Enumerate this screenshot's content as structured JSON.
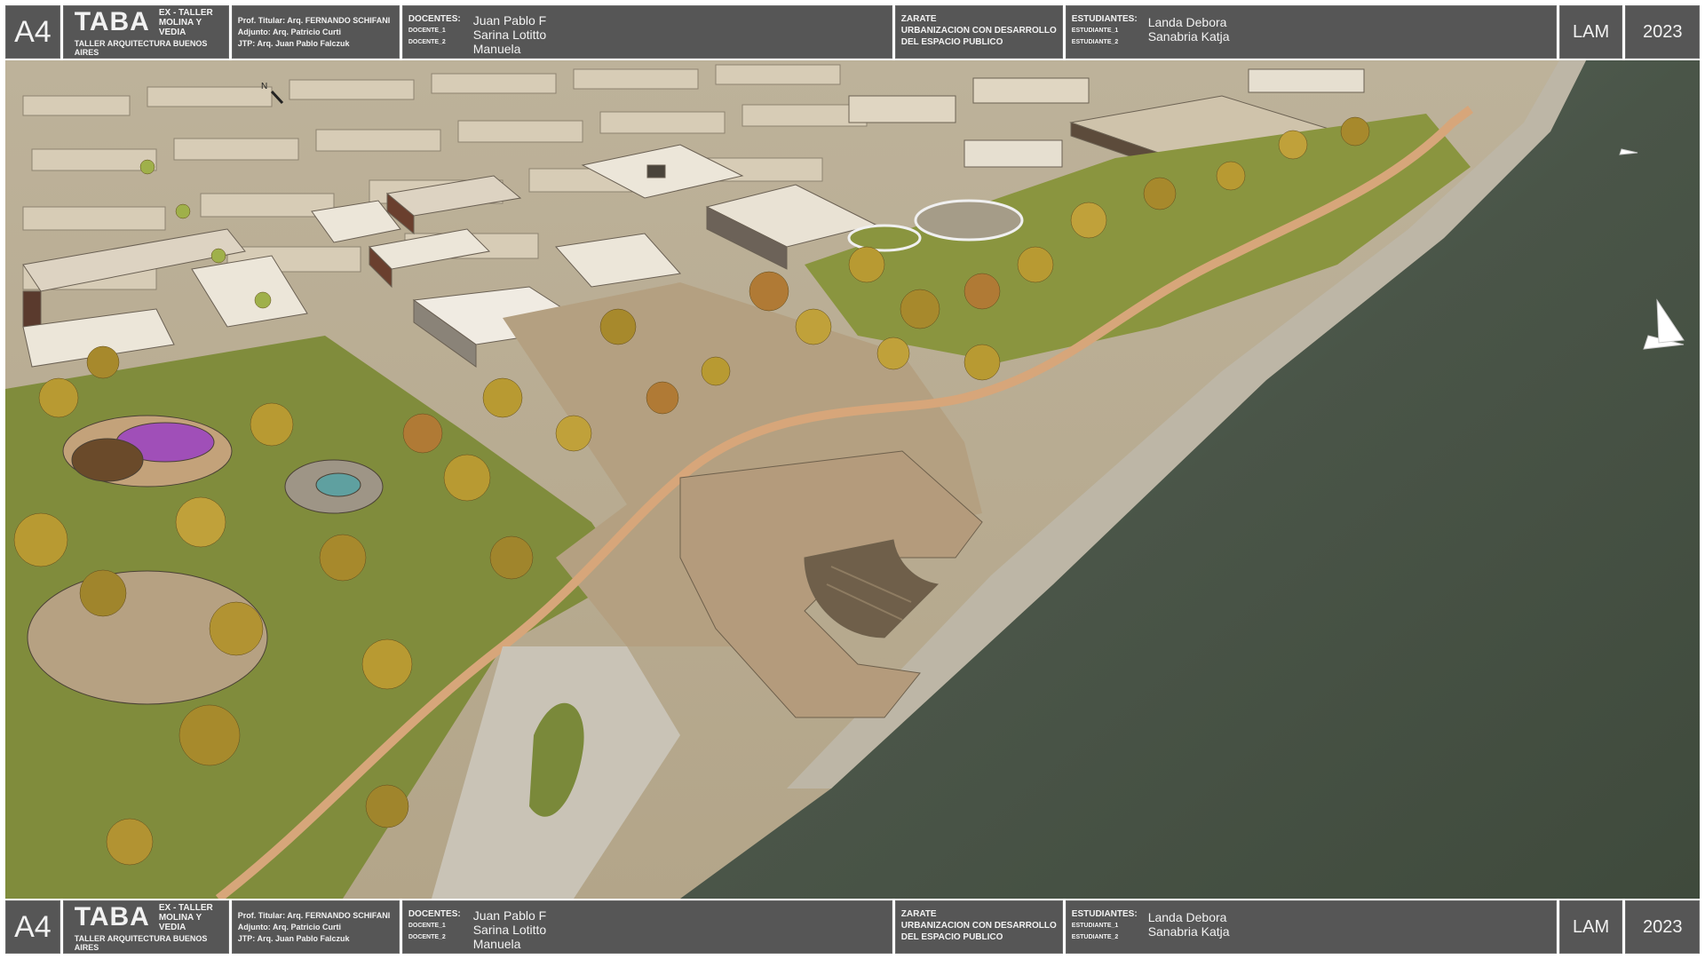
{
  "sheet": {
    "code": "A4",
    "logo": {
      "main": "TABA",
      "side_line1": "EX - TALLER",
      "side_line2": "MOLINA Y VEDIA",
      "subtitle": "TALLER ARQUITECTURA BUENOS AIRES"
    },
    "professors": {
      "titular": "Prof. Titular: Arq. FERNANDO SCHIFANI",
      "adjunto": "Adjunto: Arq. Patricio Curti",
      "jtp": "JTP: Arq. Juan Pablo Falczuk"
    },
    "docentes": {
      "label": "DOCENTES:",
      "label_1": "DOCENTE_1",
      "label_2": "DOCENTE_2",
      "name_1": "Juan Pablo F",
      "name_2": "Sarina Lotitto",
      "name_3": "Manuela"
    },
    "project": {
      "line1": "ZARATE",
      "line2": "URBANIZACION CON DESARROLLO",
      "line3": "DEL ESPACIO PUBLICO"
    },
    "students": {
      "label": "ESTUDIANTES:",
      "label_1": "ESTUDIANTE_1",
      "label_2": "ESTUDIANTE_2",
      "name_1": "Landa Debora",
      "name_2": "Sanabria Katja"
    },
    "course": "LAM",
    "year": "2023"
  },
  "render": {
    "north_label": "N",
    "colors": {
      "water": "#4a5448",
      "grass": "#7e8a3a",
      "plaza": "#b49b7c",
      "path": "#d7a67a",
      "buildings": "#d6cbb5",
      "ground": "#c8b99a",
      "tree_yellow": "#b89a32",
      "tree_orange": "#b07a35",
      "playground_purple": "#a04fb8"
    }
  }
}
